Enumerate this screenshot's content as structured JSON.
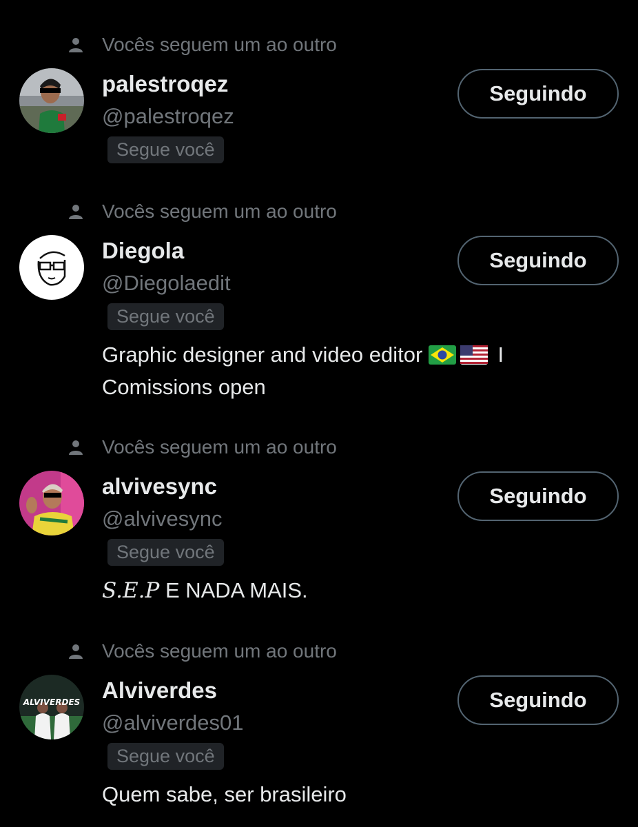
{
  "users": [
    {
      "context": "Vocês seguem um ao outro",
      "name": "palestroqez",
      "handle": "@palestroqez",
      "badge": "Segue você",
      "button": "Seguindo",
      "avatar_icon": "player-photo-avatar"
    },
    {
      "context": "Vocês seguem um ao outro",
      "name": "Diegola",
      "handle": "@Diegolaedit",
      "badge": "Segue você",
      "button": "Seguindo",
      "bio_line1": "Graphic designer and video editor",
      "bio_after_flags": "I",
      "bio_line2": "Comissions open",
      "flags": [
        "flag-brazil-icon",
        "flag-usa-icon"
      ],
      "avatar_icon": "cartoon-face-avatar"
    },
    {
      "context": "Vocês seguem um ao outro",
      "name": "alvivesync",
      "handle": "@alvivesync",
      "badge": "Segue você",
      "button": "Seguindo",
      "bio_styled": "S.E.P",
      "bio_rest": " E NADA MAIS.",
      "avatar_icon": "player-celebrating-avatar"
    },
    {
      "context": "Vocês seguem um ao outro",
      "name": "Alviverdes",
      "handle": "@alviverdes01",
      "badge": "Segue você",
      "button": "Seguindo",
      "bio": "Quem sabe, ser brasileiro",
      "avatar_logo_text": "ALVIVERDES",
      "avatar_icon": "team-logo-avatar"
    }
  ],
  "colors": {
    "background": "#000000",
    "primary_text": "#e7e9ea",
    "secondary_text": "#71767b",
    "badge_bg": "#202327",
    "button_border": "#536471"
  }
}
